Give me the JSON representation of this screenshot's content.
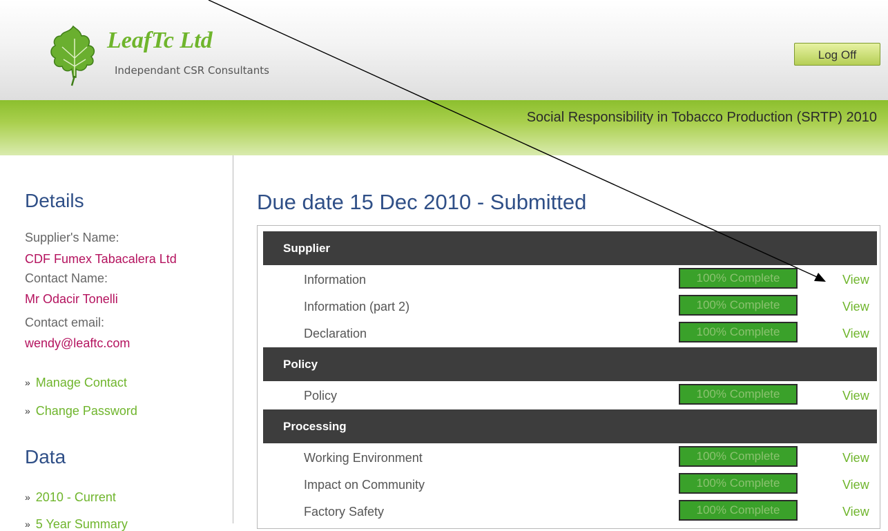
{
  "header": {
    "brand_name": "LeafTc Ltd",
    "tagline": "Independant CSR Consultants",
    "logoff_label": "Log Off"
  },
  "banner": {
    "title": "Social Responsibility in Tobacco Production (SRTP) 2010"
  },
  "sidebar": {
    "details_heading": "Details",
    "supplier_name_label": "Supplier's Name:",
    "supplier_name_value": "CDF Fumex Tabacalera Ltd",
    "contact_name_label": "Contact Name:",
    "contact_name_value": "Mr Odacir Tonelli",
    "contact_email_label": "Contact email:",
    "contact_email_value": "wendy@leaftc.com",
    "links": [
      {
        "label": "Manage Contact"
      },
      {
        "label": "Change Password"
      }
    ],
    "data_heading": "Data",
    "data_links": [
      {
        "label": "2010 - Current"
      },
      {
        "label": "5 Year Summary"
      }
    ]
  },
  "main": {
    "title": "Due date 15 Dec 2010 - Submitted",
    "sections": [
      {
        "name": "Supplier",
        "items": [
          {
            "label": "Information",
            "progress": 100,
            "status": "100% Complete",
            "action": "View"
          },
          {
            "label": "Information (part 2)",
            "progress": 100,
            "status": "100% Complete",
            "action": "View"
          },
          {
            "label": "Declaration",
            "progress": 100,
            "status": "100% Complete",
            "action": "View"
          }
        ]
      },
      {
        "name": "Policy",
        "items": [
          {
            "label": "Policy",
            "progress": 100,
            "status": "100% Complete",
            "action": "View"
          }
        ]
      },
      {
        "name": "Processing",
        "items": [
          {
            "label": "Working Environment",
            "progress": 100,
            "status": "100% Complete",
            "action": "View"
          },
          {
            "label": "Impact on Community",
            "progress": 100,
            "status": "100% Complete",
            "action": "View"
          },
          {
            "label": "Factory Safety",
            "progress": 100,
            "status": "100% Complete",
            "action": "View"
          }
        ]
      }
    ]
  },
  "colors": {
    "brand_green": "#6fb52c",
    "heading_blue": "#2f4f87",
    "value_magenta": "#b4125e",
    "section_bar": "#3d3d3d",
    "progress_green": "#3aa12a"
  }
}
